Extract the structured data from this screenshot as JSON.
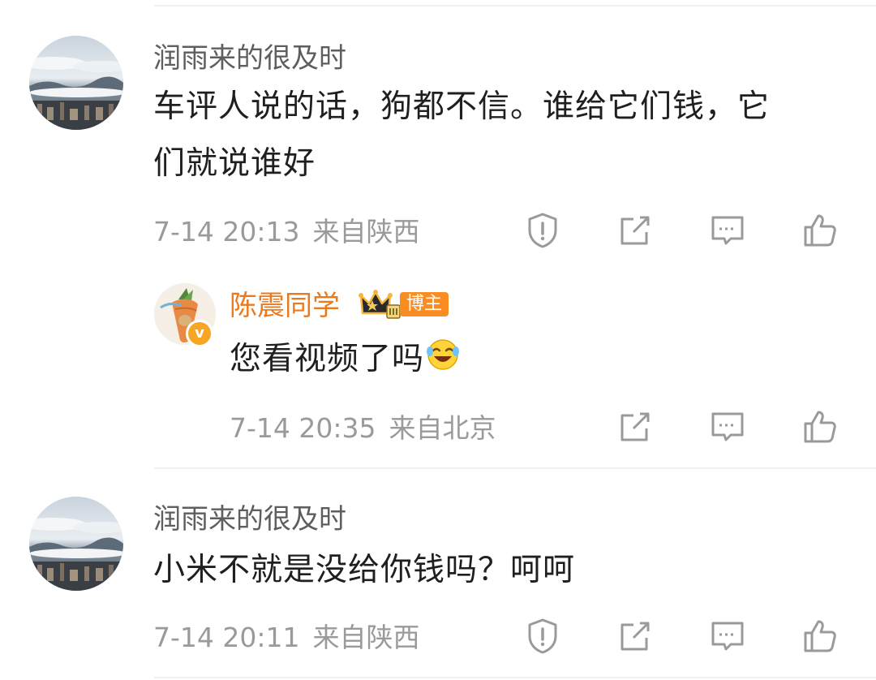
{
  "comments": [
    {
      "username": "润雨来的很及时",
      "text_line1": "车评人说的话，狗都不信。谁给它们钱，它",
      "text_line2": "们就说谁好",
      "time": "7-14 20:13",
      "location": "来自陕西",
      "reply": {
        "username": "陈震同学",
        "badge": "博主",
        "text": "您看视频了吗",
        "emoji": "laugh-cry-emoji",
        "time": "7-14 20:35",
        "location": "来自北京"
      }
    },
    {
      "username": "润雨来的很及时",
      "text": "小米不就是没给你钱吗？呵呵",
      "time": "7-14 20:11",
      "location": "来自陕西"
    }
  ],
  "colors": {
    "host_name": "#eb7a1f",
    "badge_bg": "#f98d21",
    "meta": "#9a9a9a",
    "icon": "#9a9a9a"
  }
}
